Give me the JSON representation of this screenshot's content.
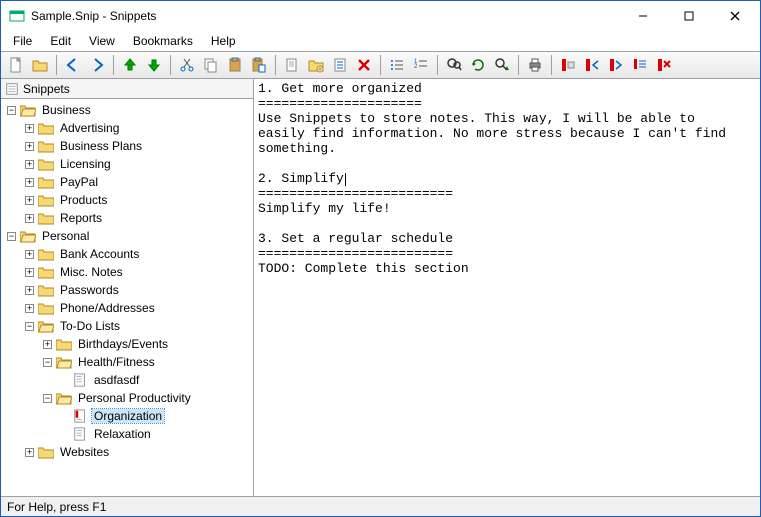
{
  "window": {
    "title": "Sample.Snip - Snippets"
  },
  "menu": {
    "file": "File",
    "edit": "Edit",
    "view": "View",
    "bookmarks": "Bookmarks",
    "help": "Help"
  },
  "tree_header": "Snippets",
  "tree": {
    "business": {
      "label": "Business",
      "children": {
        "advertising": "Advertising",
        "business_plans": "Business Plans",
        "licensing": "Licensing",
        "paypal": "PayPal",
        "products": "Products",
        "reports": "Reports"
      }
    },
    "personal": {
      "label": "Personal",
      "children": {
        "bank_accounts": "Bank Accounts",
        "misc_notes": "Misc. Notes",
        "passwords": "Passwords",
        "phone_addresses": "Phone/Addresses",
        "todo_lists": {
          "label": "To-Do Lists",
          "children": {
            "birthdays": "Birthdays/Events",
            "health": {
              "label": "Health/Fitness",
              "children": {
                "asdf": "asdfasdf"
              }
            },
            "personal_prod": {
              "label": "Personal Productivity",
              "children": {
                "organization": "Organization",
                "relaxation": "Relaxation"
              }
            }
          }
        },
        "websites": "Websites"
      }
    }
  },
  "editor": {
    "line1": "1. Get more organized",
    "line2": "=====================",
    "line3": "Use Snippets to store notes. This way, I will be able to",
    "line4": "easily find information. No more stress because I can't find",
    "line5": "something.",
    "line6": "",
    "line7": "2. Simplify",
    "line8": "=========================",
    "line9": "Simplify my life!",
    "line10": "",
    "line11": "3. Set a regular schedule",
    "line12": "=========================",
    "line13": "TODO: Complete this section"
  },
  "status": {
    "text": "For Help, press F1"
  }
}
